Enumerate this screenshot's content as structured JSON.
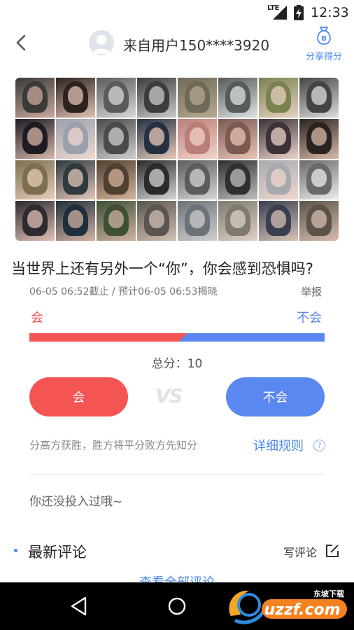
{
  "status_bar": {
    "network": "LTE",
    "time": "12:33"
  },
  "header": {
    "title": "来自用户150****3920",
    "share_label": "分享得分",
    "share_badge": "B"
  },
  "question": {
    "title": "当世界上还有另外一个“你”，你会感到恐惧吗?",
    "deadline": "06-05 06:52截止 / 预计06-05 06:53揭晓",
    "report": "举报"
  },
  "vote": {
    "option_left": "会",
    "option_right": "不会",
    "left_share": 0.52,
    "total": "总分：10",
    "vs": "VS",
    "colors": {
      "left": "#f45452",
      "right": "#5b87f0"
    }
  },
  "rules": {
    "text": "分高方获胜，胜方将平分败方先知分",
    "link": "详细规则",
    "help_icon": "?"
  },
  "investment": {
    "status": "你还没投入过哦~"
  },
  "comments": {
    "title": "最新评论",
    "write_label": "写评论",
    "view_all": "查看全部评论"
  },
  "watermark": {
    "text": "uzzf.com",
    "tag": "东坡下载"
  },
  "collage": {
    "tiles": [
      [
        "#3a3a3a",
        "#caa79a"
      ],
      [
        "#2b2320",
        "#e2c2b3"
      ],
      [
        "#5b5b5b",
        "#d8d8d8"
      ],
      [
        "#3c3c3c",
        "#c9c9c9"
      ],
      [
        "#6f6a58",
        "#b7a891"
      ],
      [
        "#555c5a",
        "#dfe2e0"
      ],
      [
        "#7c8150",
        "#e5d2c0"
      ],
      [
        "#444",
        "#ddd"
      ],
      [
        "#1e1b23",
        "#d7b6a8"
      ],
      [
        "#9aa1ad",
        "#efd7cf"
      ],
      [
        "#4a4a4a",
        "#cfcfcf"
      ],
      [
        "#253142",
        "#e7c9b9"
      ],
      [
        "#b97f78",
        "#f3d2c9"
      ],
      [
        "#7b5a52",
        "#e9c4b7"
      ],
      [
        "#3b3338",
        "#ecd3c9"
      ],
      [
        "#2a2420",
        "#d9b9a8"
      ],
      [
        "#7b6f50",
        "#e7cbb7"
      ],
      [
        "#2f3a3f",
        "#e3c6b8"
      ],
      [
        "#4f4131",
        "#d5b39b"
      ],
      [
        "#2b2b2b",
        "#d4d4d4"
      ],
      [
        "#5c5c5c",
        "#d6d6d6"
      ],
      [
        "#303030",
        "#bdbdbd"
      ],
      [
        "#a8a9ae",
        "#efd7cf"
      ],
      [
        "#6a6a6a",
        "#ececec"
      ],
      [
        "#2d2a30",
        "#e0c0b4"
      ],
      [
        "#1f2f3b",
        "#d3b1a3"
      ],
      [
        "#3d4f35",
        "#cfb29f"
      ],
      [
        "#5a5550",
        "#d2c0b2"
      ],
      [
        "#6d7278",
        "#cfcfcf"
      ],
      [
        "#7f7a6f",
        "#ddd2c4"
      ],
      [
        "#3a3f4f",
        "#d8c2b6"
      ],
      [
        "#5c5348",
        "#d7bcae"
      ]
    ]
  }
}
